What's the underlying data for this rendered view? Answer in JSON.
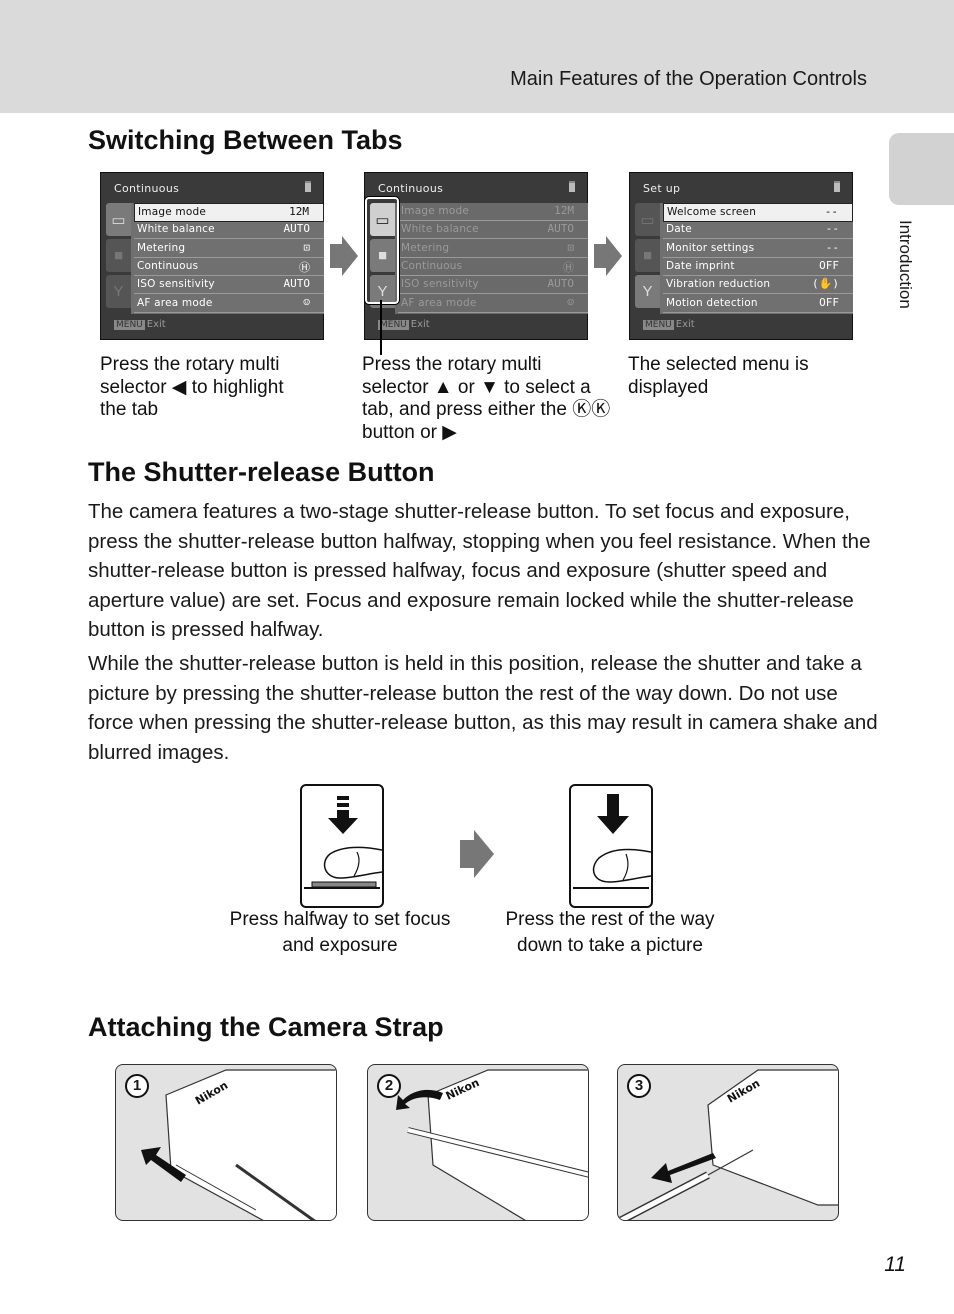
{
  "header": {
    "title": "Main Features of the Operation Controls"
  },
  "side_tab": {
    "label": "Introduction"
  },
  "page_number": "11",
  "section_tabs": {
    "heading": "Switching Between Tabs",
    "screens": [
      {
        "title": "Continuous",
        "rows": [
          {
            "label": "Image mode",
            "value": "12M"
          },
          {
            "label": "White balance",
            "value": "AUTO"
          },
          {
            "label": "Metering",
            "value": "⊡"
          },
          {
            "label": "Continuous",
            "value": "Ⓗ"
          },
          {
            "label": "ISO sensitivity",
            "value": "AUTO"
          },
          {
            "label": "AF area mode",
            "value": "☺"
          }
        ],
        "footer_key": "MENU",
        "footer_label": "Exit"
      },
      {
        "title": "Continuous",
        "rows": [
          {
            "label": "Image mode",
            "value": "12M"
          },
          {
            "label": "White balance",
            "value": "AUTO"
          },
          {
            "label": "Metering",
            "value": "⊡"
          },
          {
            "label": "Continuous",
            "value": "Ⓗ"
          },
          {
            "label": "ISO sensitivity",
            "value": "AUTO"
          },
          {
            "label": "AF area mode",
            "value": "☺"
          }
        ],
        "footer_key": "MENU",
        "footer_label": "Exit"
      },
      {
        "title": "Set up",
        "rows": [
          {
            "label": "Welcome screen",
            "value": "--"
          },
          {
            "label": "Date",
            "value": "--"
          },
          {
            "label": "Monitor settings",
            "value": "--"
          },
          {
            "label": "Date imprint",
            "value": "OFF"
          },
          {
            "label": "Vibration reduction",
            "value": "(✋)"
          },
          {
            "label": "Motion detection",
            "value": "OFF"
          }
        ],
        "footer_key": "MENU",
        "footer_label": "Exit"
      }
    ],
    "tab_icons": [
      "shooting-menu",
      "movie-menu",
      "setup-menu"
    ],
    "captions": [
      "Press the rotary multi selector ◀ to highlight the tab",
      "Press the rotary multi selector ▲ or ▼ to select a tab, and press either the Ⓚ button or ▶",
      "The selected menu is displayed"
    ],
    "caption_lines": [
      [
        "Press the rotary multi",
        "selector ◀ to highlight",
        "the tab"
      ],
      [
        "Press the rotary multi",
        "selector ▲ or ▼ to select a",
        "tab, and press either the ⓀⓀ",
        "button or ▶"
      ],
      [
        "The selected menu is",
        "displayed"
      ]
    ]
  },
  "section_shutter": {
    "heading": "The Shutter-release Button",
    "paragraphs": [
      "The camera features a two-stage shutter-release button. To set focus and exposure, press the shutter-release button halfway, stopping when you feel resistance. When the shutter-release button is pressed halfway, focus and exposure (shutter speed and aperture value) are set. Focus and exposure remain locked while the shutter-release button is pressed halfway.",
      "While the shutter-release button is held in this position, release the shutter and take a picture by pressing the shutter-release button the rest of the way down. Do not use force when pressing the shutter-release button, as this may result in camera shake and blurred images."
    ],
    "illustrations": [
      {
        "caption_line1": "Press halfway to set focus",
        "caption_line2": "and exposure"
      },
      {
        "caption_line1": "Press the rest of the way",
        "caption_line2": "down to take a picture"
      }
    ]
  },
  "section_strap": {
    "heading": "Attaching the Camera Strap",
    "steps": [
      "1",
      "2",
      "3"
    ],
    "brand": "Nikon"
  }
}
